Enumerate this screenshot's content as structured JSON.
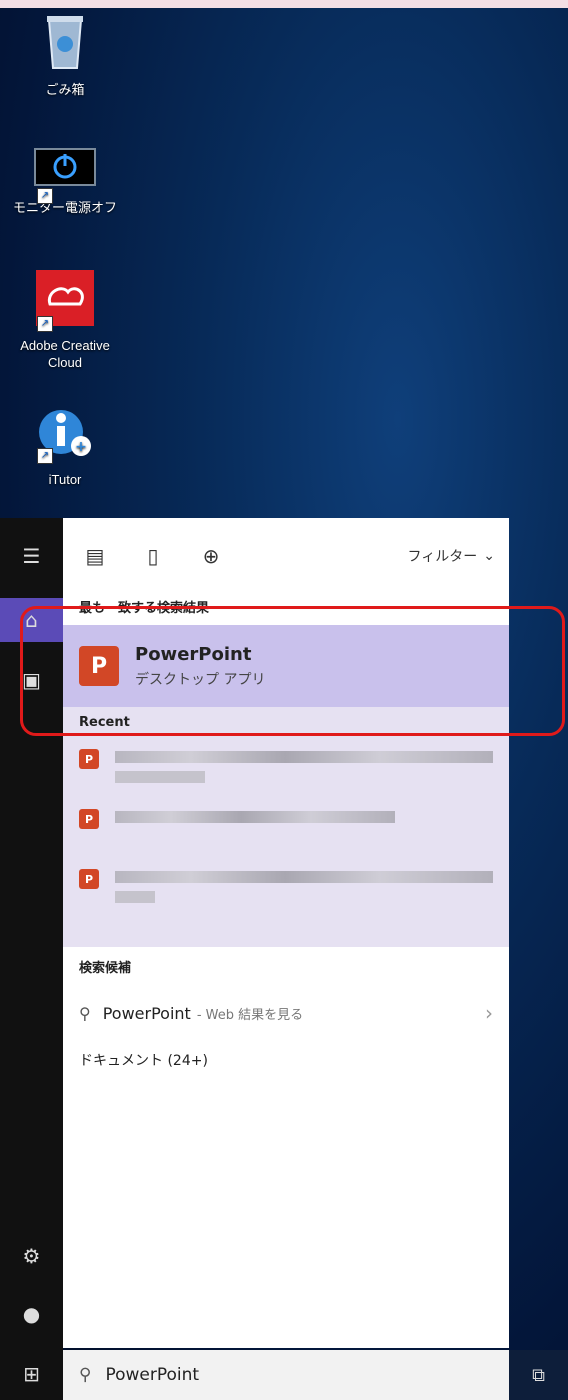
{
  "desktop": {
    "icons": [
      {
        "label": "ごみ箱",
        "icon": "recycle-bin-icon"
      },
      {
        "label": "モニター電源オフ",
        "icon": "monitor-power-off-icon"
      },
      {
        "label": "Adobe Creative Cloud",
        "icon": "adobe-creative-cloud-icon"
      },
      {
        "label": "iTutor",
        "icon": "itutor-icon"
      }
    ]
  },
  "search_panel": {
    "filter_label": "フィルター",
    "best_match_heading": "最も一致する検索結果",
    "best_match": {
      "title": "PowerPoint",
      "subtitle": "デスクトップ アプリ"
    },
    "recent_heading": "Recent",
    "suggestions_heading": "検索候補",
    "web_suggestion": {
      "term": "PowerPoint",
      "suffix": "- Web 結果を見る"
    },
    "documents_label": "ドキュメント (24+)"
  },
  "search_box": {
    "value": "PowerPoint"
  },
  "colors": {
    "highlight": "#e01a1a",
    "best_match_bg": "#c9c1ec",
    "powerpoint": "#d24726"
  }
}
